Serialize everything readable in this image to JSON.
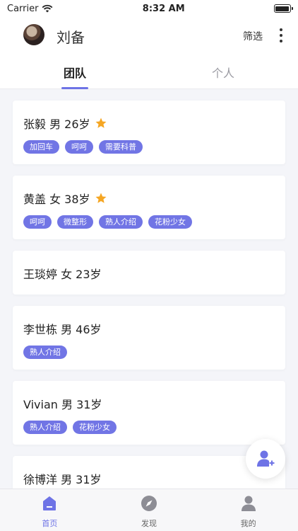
{
  "status_bar": {
    "carrier": "Carrier",
    "time": "8:32 AM"
  },
  "header": {
    "user_name": "刘备",
    "filter_label": "筛选"
  },
  "tabs": [
    {
      "label": "团队",
      "active": true
    },
    {
      "label": "个人",
      "active": false
    }
  ],
  "colors": {
    "accent": "#6e73e6",
    "tag_bg": "#7175e5",
    "star": "#f5a623"
  },
  "cards": [
    {
      "title": "张毅  男  26岁",
      "starred": true,
      "tags": [
        "加回车",
        "呵呵",
        "需要科普"
      ]
    },
    {
      "title": "黄盖  女  38岁",
      "starred": true,
      "tags": [
        "呵呵",
        "微整形",
        "熟人介绍",
        "花粉少女"
      ]
    },
    {
      "title": "王琰婷  女  23岁",
      "starred": false,
      "tags": []
    },
    {
      "title": "李世栋  男  46岁",
      "starred": false,
      "tags": [
        "熟人介绍"
      ]
    },
    {
      "title": "Vivian  男  31岁",
      "starred": false,
      "tags": [
        "熟人介绍",
        "花粉少女"
      ]
    },
    {
      "title": "徐博洋  男  31岁",
      "starred": false,
      "tags": []
    }
  ],
  "bottom_nav": [
    {
      "label": "首页",
      "icon": "home-icon",
      "active": true
    },
    {
      "label": "发现",
      "icon": "compass-icon",
      "active": false
    },
    {
      "label": "我的",
      "icon": "profile-icon",
      "active": false
    }
  ]
}
